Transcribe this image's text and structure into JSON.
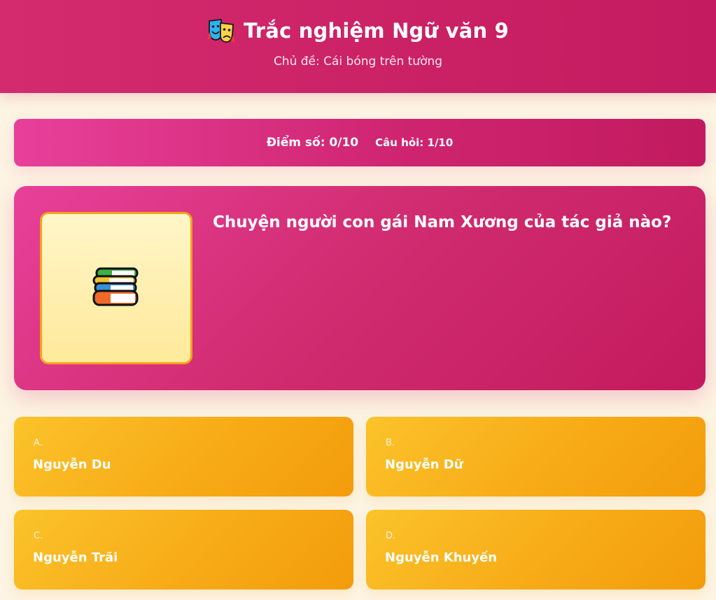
{
  "header": {
    "title": "Trắc nghiệm Ngữ văn 9",
    "subtitle": "Chủ đề: Cái bóng trên tường",
    "title_icon": "theater-masks-icon"
  },
  "status": {
    "score": "Điểm số: 0/10",
    "question_number": "Câu hỏi: 1/10"
  },
  "question": {
    "image_icon": "books-icon",
    "text": "Chuyện người con gái Nam Xương của tác giả nào?"
  },
  "options": [
    {
      "letter": "A.",
      "text": "Nguyễn Du"
    },
    {
      "letter": "B.",
      "text": "Nguyễn Dữ"
    },
    {
      "letter": "C.",
      "text": "Nguyễn Trãi"
    },
    {
      "letter": "D.",
      "text": "Nguyễn Khuyến"
    }
  ],
  "colors": {
    "header": "#c41a5f",
    "card_pink": "#e8409a",
    "option_orange": "#f7ab17",
    "image_border": "#f4a11a",
    "background": "#fdf4e3"
  }
}
